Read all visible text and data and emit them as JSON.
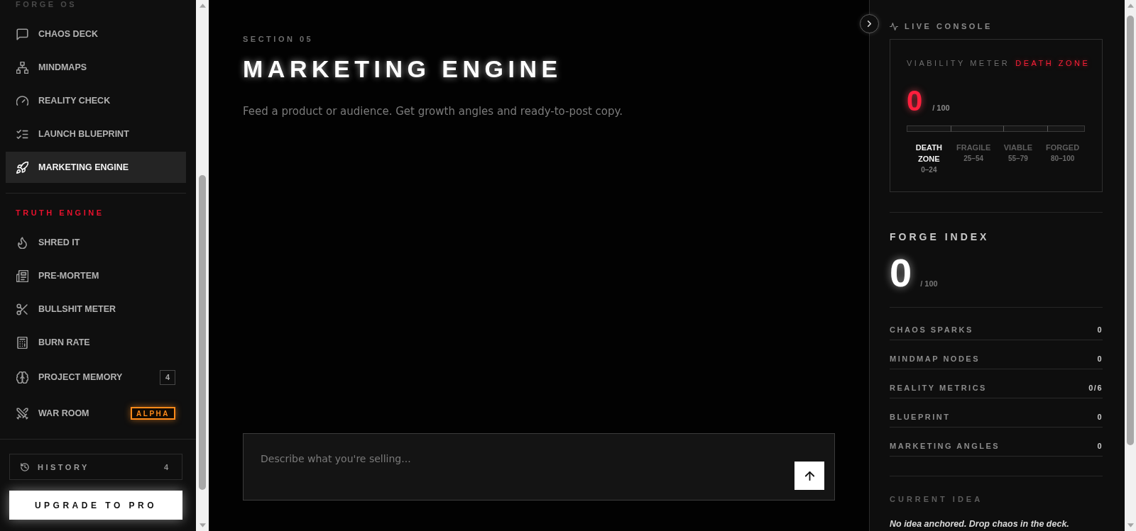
{
  "sidebar": {
    "groups": [
      {
        "title": "FORGE OS",
        "color": "#4a4a4a",
        "items": [
          {
            "label": "CHAOS DECK",
            "selected": false
          },
          {
            "label": "MINDMAPS",
            "selected": false
          },
          {
            "label": "REALITY CHECK",
            "selected": false
          },
          {
            "label": "LAUNCH BLUEPRINT",
            "selected": false
          },
          {
            "label": "MARKETING ENGINE",
            "selected": true
          }
        ]
      },
      {
        "title": "TRUTH ENGINE",
        "color": "#e8112d",
        "items": [
          {
            "label": "SHRED IT",
            "selected": false
          },
          {
            "label": "PRE-MORTEM",
            "selected": false
          },
          {
            "label": "BULLSHIT METER",
            "selected": false
          },
          {
            "label": "BURN RATE",
            "selected": false
          },
          {
            "label": "PROJECT MEMORY",
            "selected": false,
            "badge": {
              "kind": "count",
              "text": "4"
            }
          },
          {
            "label": "WAR ROOM",
            "selected": false,
            "badge": {
              "kind": "tag",
              "text": "ALPHA"
            }
          }
        ]
      }
    ],
    "history": {
      "label": "HISTORY",
      "count": "4"
    },
    "upgrade_button": "UPGRADE TO PRO"
  },
  "main": {
    "eyebrow": "SECTION 05",
    "title": "MARKETING ENGINE",
    "subtitle": "Feed a product or audience. Get growth angles and ready-to-post copy.",
    "composer": {
      "placeholder": "Describe what you're selling..."
    }
  },
  "live_console": {
    "title": "LIVE CONSOLE",
    "viability": {
      "label": "VIABILITY METER",
      "status": "DEATH ZONE",
      "score": "0",
      "max": "/ 100",
      "zones": [
        {
          "name": "DEATH ZONE",
          "range": "0–24",
          "selected": true
        },
        {
          "name": "FRAGILE",
          "range": "25–54",
          "selected": false
        },
        {
          "name": "VIABLE",
          "range": "55–79",
          "selected": false
        },
        {
          "name": "FORGED",
          "range": "80–100",
          "selected": false
        }
      ]
    },
    "forge_index": {
      "title": "FORGE INDEX",
      "score": "0",
      "max": "/ 100"
    },
    "stats": [
      {
        "label": "CHAOS SPARKS",
        "value": "0"
      },
      {
        "label": "MINDMAP NODES",
        "value": "0"
      },
      {
        "label": "REALITY METRICS",
        "value": "0/6"
      },
      {
        "label": "BLUEPRINT",
        "value": "0"
      },
      {
        "label": "MARKETING ANGLES",
        "value": "0"
      }
    ],
    "current_idea": {
      "title": "CURRENT IDEA",
      "text": "No idea anchored. Drop chaos in the deck."
    }
  }
}
